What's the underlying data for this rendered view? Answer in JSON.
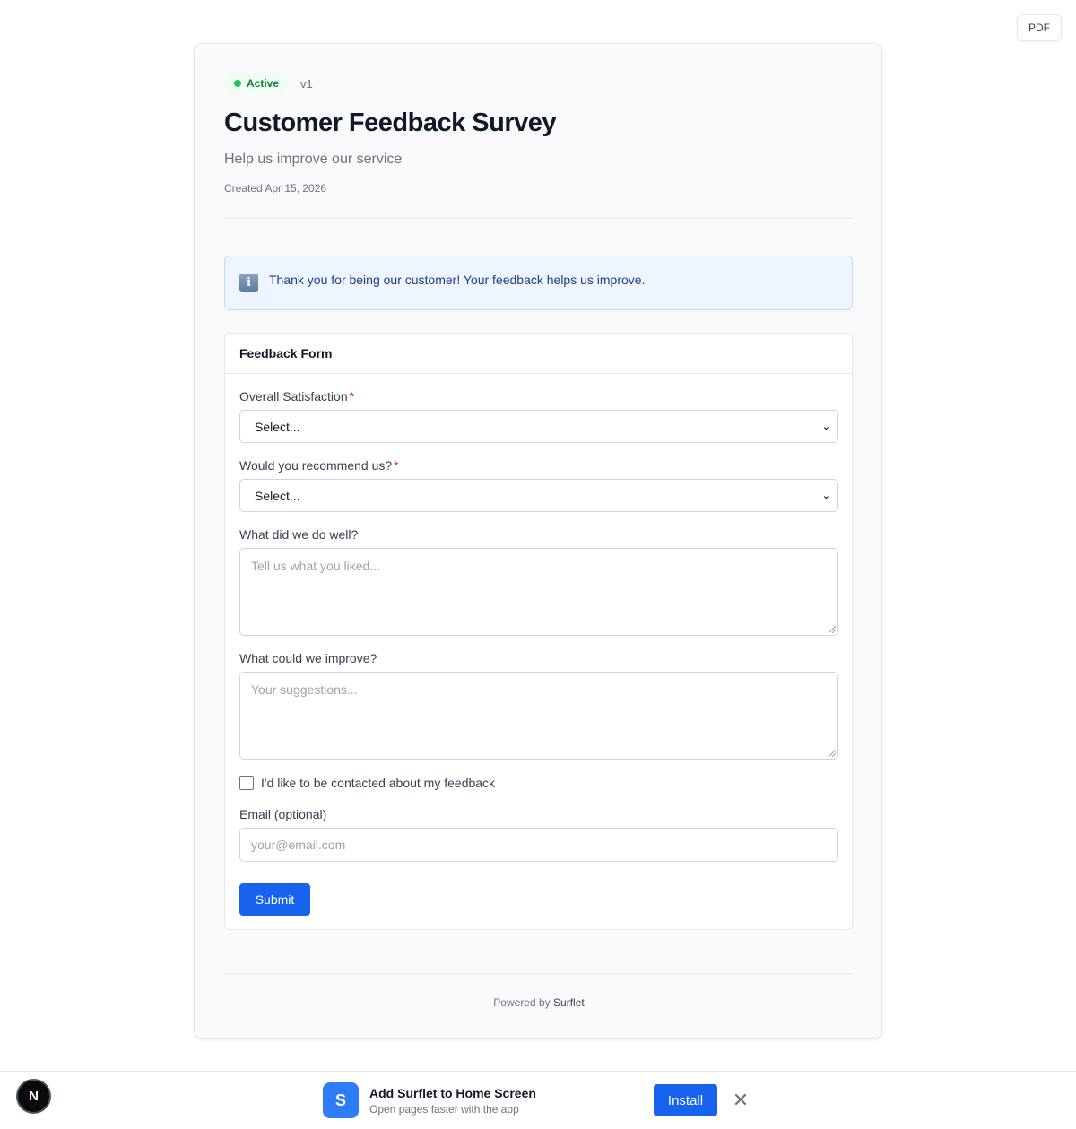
{
  "toolbar": {
    "pdf_label": "PDF"
  },
  "header": {
    "status": "Active",
    "version": "v1",
    "title": "Customer Feedback Survey",
    "subtitle": "Help us improve our service",
    "created": "Created Apr 15, 2026"
  },
  "notice": {
    "icon": "info-icon",
    "text": "Thank you for being our customer! Your feedback helps us improve."
  },
  "form": {
    "title": "Feedback Form",
    "fields": {
      "satisfaction": {
        "label": "Overall Satisfaction",
        "required_mark": "*",
        "value": "Select..."
      },
      "recommend": {
        "label": "Would you recommend us?",
        "required_mark": "*",
        "value": "Select..."
      },
      "well": {
        "label": "What did we do well?",
        "placeholder": "Tell us what you liked..."
      },
      "improve": {
        "label": "What could we improve?",
        "placeholder": "Your suggestions..."
      },
      "contact": {
        "label": "I'd like to be contacted about my feedback",
        "checked": false
      },
      "email": {
        "label": "Email (optional)",
        "placeholder": "your@email.com"
      }
    },
    "submit_label": "Submit"
  },
  "footer": {
    "powered_prefix": "Powered by",
    "brand": "Surflet"
  },
  "install_banner": {
    "badge_letter": "N",
    "app_letter": "S",
    "title": "Add Surflet to Home Screen",
    "subtitle": "Open pages faster with the app",
    "install_label": "Install",
    "close_symbol": "✕"
  },
  "colors": {
    "primary": "#1763ee",
    "active": "#15803d",
    "required": "#dc2626",
    "info_bg": "#eef5fe"
  }
}
